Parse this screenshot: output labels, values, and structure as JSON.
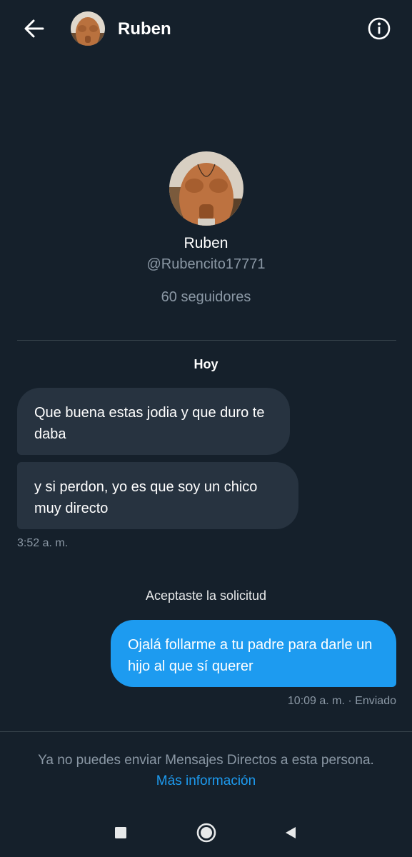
{
  "header": {
    "back_icon": "arrow-left-icon",
    "name": "Ruben",
    "info_icon": "info-circle-icon"
  },
  "profile": {
    "name": "Ruben",
    "handle": "@Rubencito17771",
    "followers": "60 seguidores"
  },
  "conversation": {
    "date_separator": "Hoy",
    "incoming": [
      {
        "text": "Que buena estas jodia y que duro te daba"
      },
      {
        "text": "y si perdon, yo es que soy un chico muy directo"
      }
    ],
    "incoming_time": "3:52 a. m.",
    "system_message": "Aceptaste la solicitud",
    "outgoing": [
      {
        "text": "Ojalá follarme a tu padre para darle un hijo al que sí querer"
      }
    ],
    "outgoing_status": "10:09 a. m. · Enviado"
  },
  "footer": {
    "restriction_text": "Ya no puedes enviar Mensajes Directos a esta persona.",
    "more_info_link": "Más información"
  },
  "system_nav": {
    "recents_icon": "square-recents-icon",
    "home_icon": "circle-home-icon",
    "back_icon": "triangle-back-icon"
  },
  "colors": {
    "background": "#15202b",
    "incoming_bubble": "#273340",
    "outgoing_bubble": "#1d9bf0",
    "secondary_text": "#8b98a5",
    "link": "#1d9bf0"
  }
}
